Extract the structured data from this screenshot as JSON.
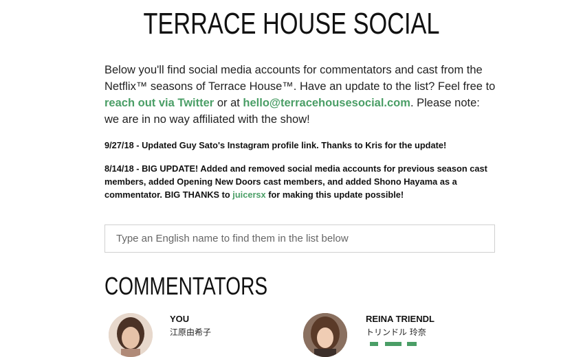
{
  "header": {
    "title": "TERRACE HOUSE SOCIAL"
  },
  "intro": {
    "text_1": "Below you'll find social media accounts for commentators and cast from the Netflix™ seasons of Terrace House™. Have an update to the list? Feel free to ",
    "twitter_link": "reach out via Twitter",
    "text_2": " or at ",
    "email_link": "hello@terracehousesocial.com",
    "text_3": ". Please note: we are in no way affiliated with the show!"
  },
  "updates": [
    {
      "text": "9/27/18 - Updated Guy Sato's Instagram profile link. Thanks to Kris for the update!"
    },
    {
      "text_1": "8/14/18 - BIG UPDATE! Added and removed social media accounts for previous season cast members, added Opening New Doors cast members, and added Shono Hayama as a commentator. BIG THANKS to ",
      "link": "juicersx",
      "text_2": " for making this update possible!"
    }
  ],
  "search": {
    "placeholder": "Type an English name to find them in the list below"
  },
  "commentators": {
    "heading": "COMMENTATORS",
    "people": [
      {
        "name": "YOU",
        "jp_name": "江原由希子"
      },
      {
        "name": "REINA TRIENDL",
        "jp_name": "トリンドル 玲奈"
      }
    ]
  },
  "colors": {
    "accent": "#4a9e66",
    "text": "#111111",
    "border": "#cfcfcf"
  }
}
